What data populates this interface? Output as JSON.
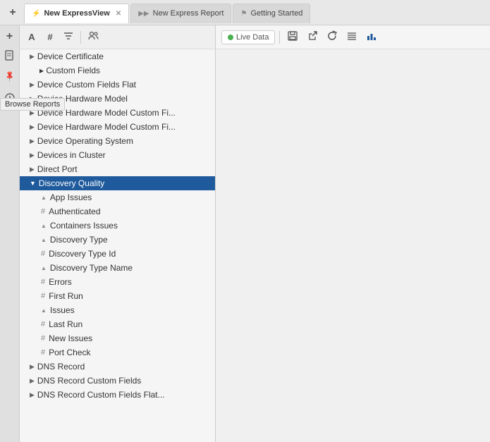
{
  "tabs": [
    {
      "id": "new-expressview",
      "label": "New ExpressView",
      "icon": "⚡",
      "iconColor": "#f5a623",
      "active": true,
      "closable": true
    },
    {
      "id": "new-express-report",
      "label": "New Express Report",
      "icon": "▶▶",
      "iconColor": "#888",
      "active": false,
      "closable": false
    },
    {
      "id": "getting-started",
      "label": "Getting Started",
      "icon": "⚑",
      "iconColor": "#888",
      "active": false,
      "closable": false
    }
  ],
  "sidebar_icons": [
    {
      "id": "new-icon",
      "symbol": "+",
      "title": "New"
    },
    {
      "id": "doc-icon",
      "symbol": "📄",
      "title": "Document"
    },
    {
      "id": "pin-icon",
      "symbol": "📌",
      "title": "Pin"
    },
    {
      "id": "clock-icon",
      "symbol": "🕐",
      "title": "History"
    }
  ],
  "browse_reports_label": "Browse Reports",
  "tree_toolbar": {
    "icons": [
      {
        "id": "text-icon",
        "symbol": "A",
        "title": "Text"
      },
      {
        "id": "hash-icon",
        "symbol": "#",
        "title": "Hash"
      },
      {
        "id": "filter-icon",
        "symbol": "≡",
        "title": "Filter"
      },
      {
        "id": "people-icon",
        "symbol": "⚇",
        "title": "People"
      }
    ]
  },
  "tree_items": [
    {
      "id": "device-certificate",
      "label": "Device Certificate",
      "level": 1,
      "arrow": "▶",
      "hasArrow": true,
      "icon": ""
    },
    {
      "id": "device-custom-fields",
      "label": "▸ Custom Fields",
      "level": 1,
      "arrow": "",
      "hasArrow": false,
      "icon": ""
    },
    {
      "id": "device-custom-fields-flat",
      "label": "Device Custom Fields Flat",
      "level": 1,
      "arrow": "▶",
      "hasArrow": true,
      "icon": ""
    },
    {
      "id": "device-hardware-model",
      "label": "Device Hardware Model",
      "level": 1,
      "arrow": "▶",
      "hasArrow": true,
      "icon": ""
    },
    {
      "id": "device-hardware-model-custom-fi-1",
      "label": "Device Hardware Model Custom Fi...",
      "level": 1,
      "arrow": "▶",
      "hasArrow": true,
      "icon": ""
    },
    {
      "id": "device-hardware-model-custom-fi-2",
      "label": "Device Hardware Model Custom Fi...",
      "level": 1,
      "arrow": "▶",
      "hasArrow": true,
      "icon": ""
    },
    {
      "id": "device-operating-system",
      "label": "Device Operating System",
      "level": 1,
      "arrow": "▶",
      "hasArrow": true,
      "icon": ""
    },
    {
      "id": "devices-in-cluster",
      "label": "Devices in Cluster",
      "level": 1,
      "arrow": "▶",
      "hasArrow": true,
      "icon": ""
    },
    {
      "id": "direct-port",
      "label": "Direct Port",
      "level": 1,
      "arrow": "▶",
      "hasArrow": true,
      "icon": ""
    },
    {
      "id": "discovery-quality",
      "label": "Discovery Quality",
      "level": 1,
      "arrow": "▼",
      "hasArrow": true,
      "icon": "",
      "selected": true
    },
    {
      "id": "app-issues",
      "label": "App Issues",
      "level": 2,
      "arrow": "",
      "hasArrow": false,
      "icon": "▲",
      "iconType": "triangle"
    },
    {
      "id": "authenticated",
      "label": "Authenticated",
      "level": 2,
      "arrow": "",
      "hasArrow": false,
      "icon": "#",
      "iconType": "hash"
    },
    {
      "id": "containers-issues",
      "label": "Containers Issues",
      "level": 2,
      "arrow": "",
      "hasArrow": false,
      "icon": "▲",
      "iconType": "triangle"
    },
    {
      "id": "discovery-type",
      "label": "Discovery Type",
      "level": 2,
      "arrow": "",
      "hasArrow": false,
      "icon": "▲",
      "iconType": "triangle"
    },
    {
      "id": "discovery-type-id",
      "label": "Discovery Type Id",
      "level": 2,
      "arrow": "",
      "hasArrow": false,
      "icon": "#",
      "iconType": "hash"
    },
    {
      "id": "discovery-type-name",
      "label": "Discovery Type Name",
      "level": 2,
      "arrow": "",
      "hasArrow": false,
      "icon": "▲",
      "iconType": "triangle"
    },
    {
      "id": "errors",
      "label": "Errors",
      "level": 2,
      "arrow": "",
      "hasArrow": false,
      "icon": "#",
      "iconType": "hash"
    },
    {
      "id": "first-run",
      "label": "First Run",
      "level": 2,
      "arrow": "",
      "hasArrow": false,
      "icon": "#",
      "iconType": "hash"
    },
    {
      "id": "issues",
      "label": "Issues",
      "level": 2,
      "arrow": "",
      "hasArrow": false,
      "icon": "▲",
      "iconType": "triangle"
    },
    {
      "id": "last-run",
      "label": "Last Run",
      "level": 2,
      "arrow": "",
      "hasArrow": false,
      "icon": "#",
      "iconType": "hash"
    },
    {
      "id": "new-issues",
      "label": "New Issues",
      "level": 2,
      "arrow": "",
      "hasArrow": false,
      "icon": "#",
      "iconType": "hash"
    },
    {
      "id": "port-check",
      "label": "Port Check",
      "level": 2,
      "arrow": "",
      "hasArrow": false,
      "icon": "#",
      "iconType": "hash"
    },
    {
      "id": "dns-record",
      "label": "DNS Record",
      "level": 1,
      "arrow": "▶",
      "hasArrow": true,
      "icon": ""
    },
    {
      "id": "dns-record-custom-fields",
      "label": "DNS Record Custom Fields",
      "level": 1,
      "arrow": "▶",
      "hasArrow": true,
      "icon": ""
    },
    {
      "id": "dns-record-custom-fields-flat",
      "label": "DNS Record Custom Fields Flat...",
      "level": 1,
      "arrow": "▶",
      "hasArrow": true,
      "icon": ""
    }
  ],
  "content_toolbar": {
    "live_data_label": "Live Data",
    "buttons": [
      {
        "id": "save-btn",
        "symbol": "💾",
        "title": "Save"
      },
      {
        "id": "export-btn",
        "symbol": "↗",
        "title": "Export"
      },
      {
        "id": "refresh-btn",
        "symbol": "↺",
        "title": "Refresh"
      },
      {
        "id": "list-btn",
        "symbol": "≡",
        "title": "List"
      },
      {
        "id": "chart-btn",
        "symbol": "📊",
        "title": "Chart"
      }
    ]
  }
}
